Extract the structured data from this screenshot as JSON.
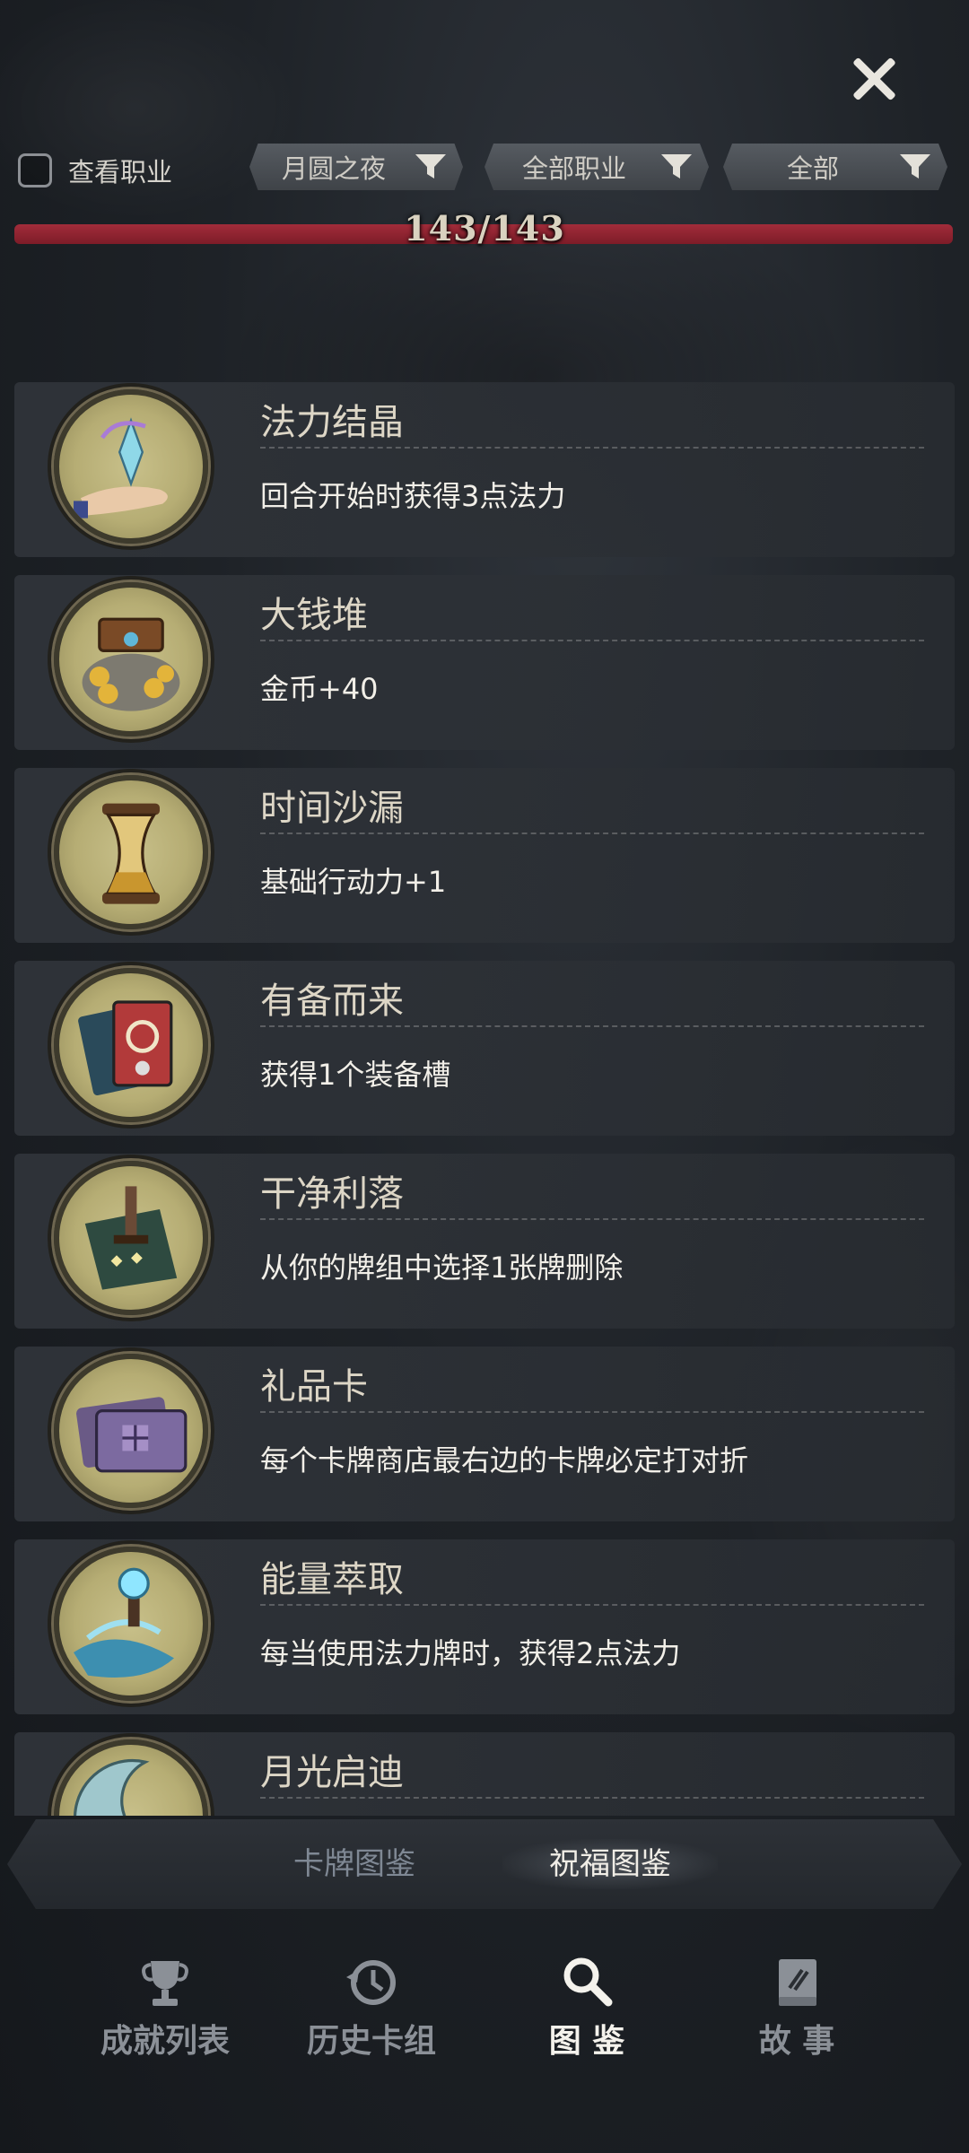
{
  "header": {
    "view_class_label": "查看职业",
    "filters": [
      {
        "label": "月圆之夜"
      },
      {
        "label": "全部职业"
      },
      {
        "label": "全部"
      }
    ],
    "progress_text": "143/143"
  },
  "blessings": [
    {
      "title": "法力结晶",
      "description": "回合开始时获得3点法力",
      "icon": "crystal-hand-icon"
    },
    {
      "title": "大钱堆",
      "description": "金币+40",
      "icon": "treasure-gold-icon"
    },
    {
      "title": "时间沙漏",
      "description": "基础行动力+1",
      "icon": "hourglass-icon"
    },
    {
      "title": "有备而来",
      "description": "获得1个装备槽",
      "icon": "cards-icon"
    },
    {
      "title": "干净利落",
      "description": "从你的牌组中选择1张牌删除",
      "icon": "dagger-card-icon"
    },
    {
      "title": "礼品卡",
      "description": "每个卡牌商店最右边的卡牌必定打对折",
      "icon": "gift-card-icon"
    },
    {
      "title": "能量萃取",
      "description": "每当使用法力牌时，获得2点法力",
      "icon": "energy-orb-icon"
    },
    {
      "title": "月光启迪",
      "description": "",
      "icon": "moon-icon"
    }
  ],
  "subtabs": {
    "cards": "卡牌图鉴",
    "blessings": "祝福图鉴"
  },
  "bottom_nav": [
    {
      "label": "成就列表",
      "icon": "trophy-icon"
    },
    {
      "label": "历史卡组",
      "icon": "history-icon"
    },
    {
      "label": "图 鉴",
      "icon": "magnifier-icon"
    },
    {
      "label": "故 事",
      "icon": "book-icon"
    }
  ]
}
